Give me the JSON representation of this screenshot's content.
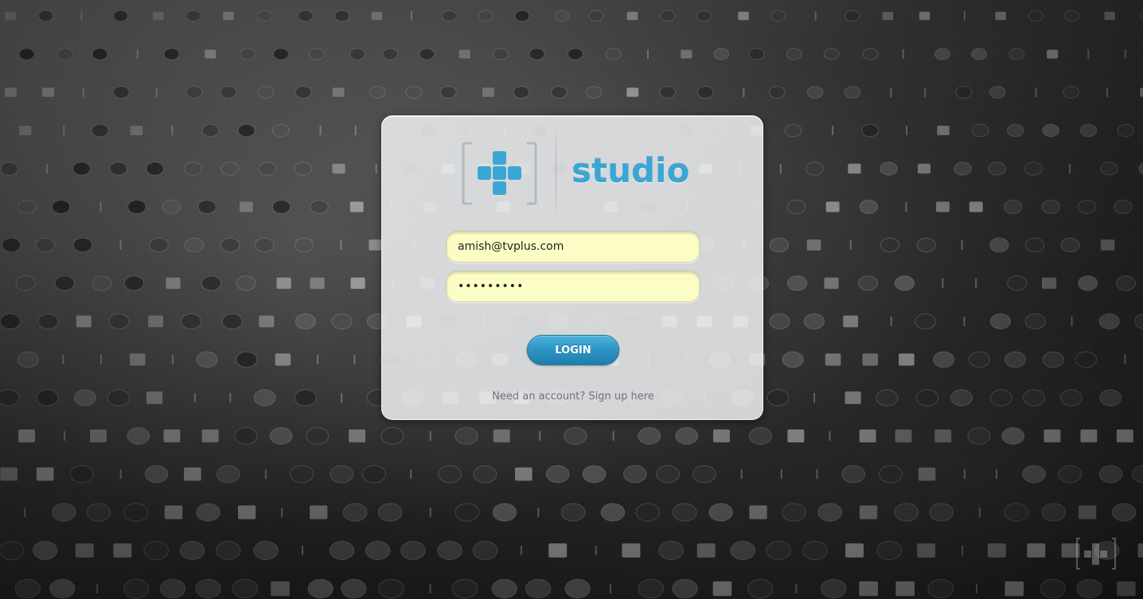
{
  "brand": {
    "name": "studio",
    "accent_color": "#3aa6d4",
    "logo_icon": "bracketed-plus-icon"
  },
  "login_form": {
    "email_value": "amish@tvplus.com",
    "password_value": "•••••••••",
    "login_label": "LOGIN",
    "signup_text": "Need an account? Sign up here"
  },
  "colors": {
    "field_background": "#fbfdc4",
    "button_blue": "#2c94c4",
    "card_background": "#eef0f2"
  }
}
